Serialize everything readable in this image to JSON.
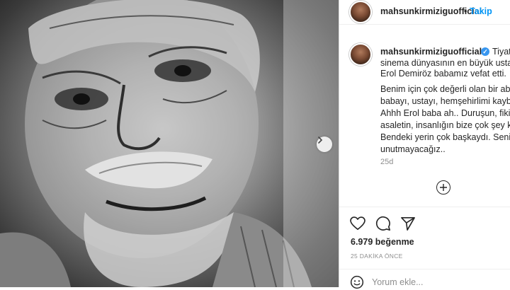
{
  "post": {
    "username": "mahsunkirmiziguofficial",
    "follow_label": "Takip",
    "separator": "•",
    "caption_first": "Tiyat",
    "caption_lines": [
      "sinema dünyasının en büyük usta",
      "Erol Demiröz babamız vefat etti.",
      "Benim için çok değerli olan bir ab",
      "babayı, ustayı, hemşehirlimi kaybe",
      "Ahhh Erol baba ah.. Duruşun, fikir",
      "asaletin, insanlığın bize çok şey ka",
      "Bendeki yerin çok başkaydı. Seni",
      "unutmayacağız.."
    ],
    "caption_username": "mahsunkirmiziguofficial",
    "verified_mark": "✓",
    "time_ago": "25d",
    "likes": "6.979 beğenme",
    "posted_time": "25 DAKİKA ÖNCE"
  },
  "comment": {
    "placeholder": "Yorum ekle..."
  },
  "icons": {
    "carousel_next": "chevron-right-icon",
    "add_comment": "plus-circle-icon",
    "like": "heart-icon",
    "comment": "comment-bubble-icon",
    "share": "paper-plane-icon",
    "emoji": "smiley-icon"
  },
  "colors": {
    "accent": "#0095f6",
    "verified": "#3897f0",
    "muted": "#8e8e8e",
    "text": "#262626"
  }
}
